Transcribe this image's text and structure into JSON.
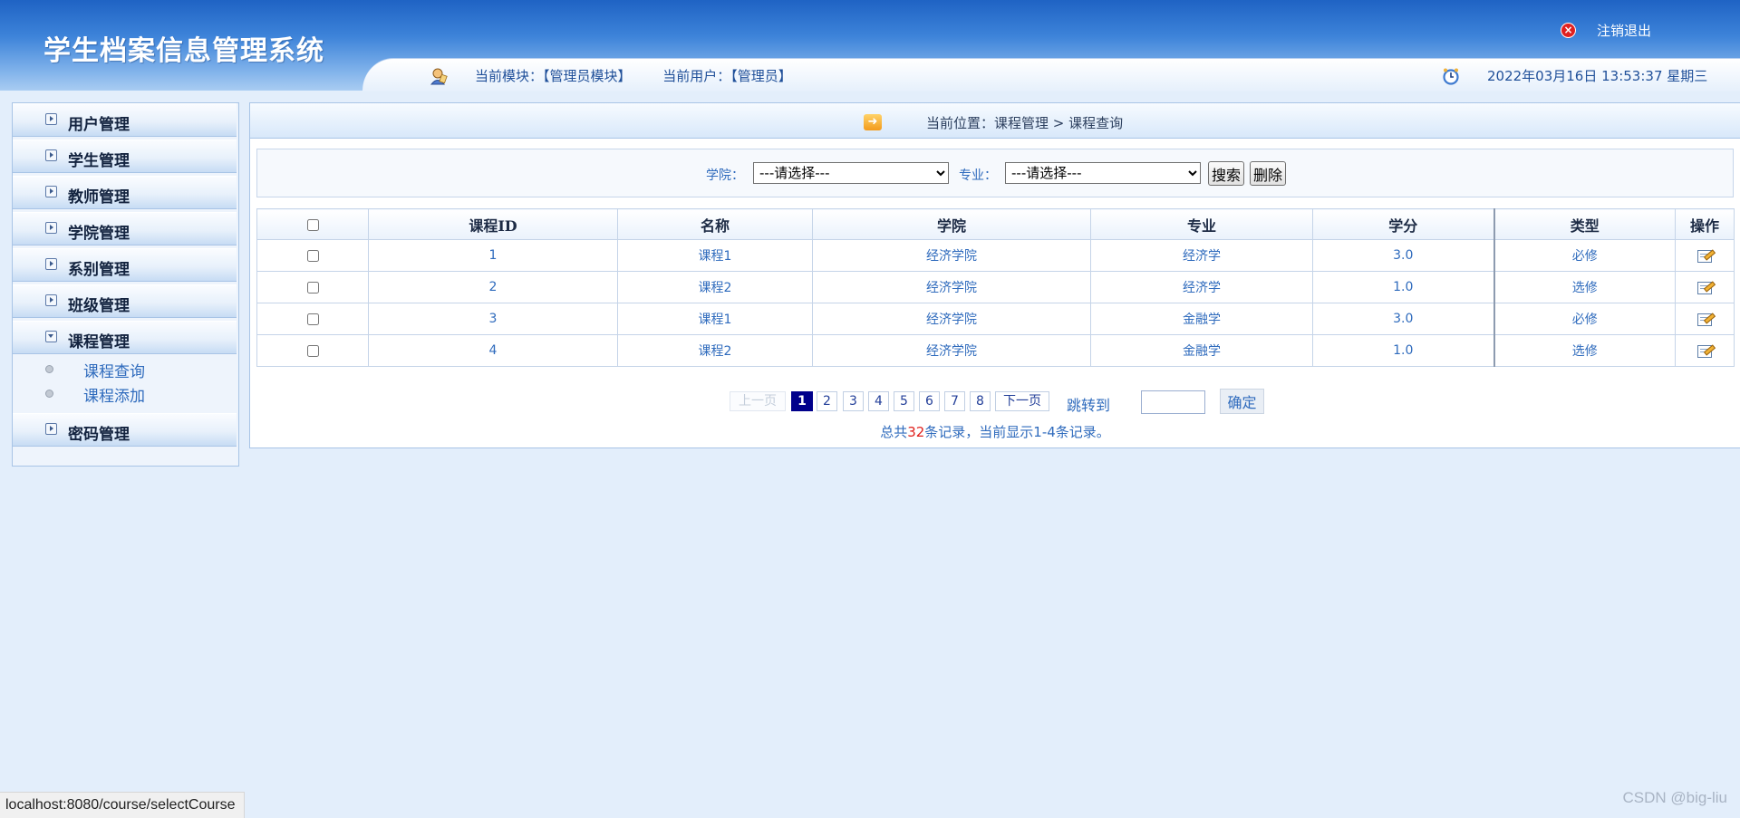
{
  "header": {
    "app_title": "学生档案信息管理系统",
    "logout_label": "注销退出",
    "module_text": "当前模块：【管理员模块】",
    "user_text": "当前用户：【管理员】",
    "datetime": "2022年03月16日 13:53:37 星期三"
  },
  "sidebar": {
    "menus": [
      {
        "label": "用户管理",
        "icon": "expand-icon"
      },
      {
        "label": "学生管理",
        "icon": "expand-icon"
      },
      {
        "label": "教师管理",
        "icon": "expand-icon"
      },
      {
        "label": "学院管理",
        "icon": "expand-icon"
      },
      {
        "label": "系别管理",
        "icon": "expand-icon"
      },
      {
        "label": "班级管理",
        "icon": "expand-icon"
      },
      {
        "label": "课程管理",
        "icon": "collapse-icon",
        "open": true
      },
      {
        "label": "密码管理",
        "icon": "expand-icon"
      }
    ],
    "course_submenu": [
      {
        "label": "课程查询"
      },
      {
        "label": "课程添加"
      }
    ]
  },
  "location": {
    "text": "当前位置：课程管理 > 课程查询"
  },
  "search": {
    "college_label": "学院：",
    "college_value": "---请选择---",
    "major_label": "专业：",
    "major_value": "---请选择---",
    "search_button": "搜索",
    "delete_button": "删除"
  },
  "table": {
    "columns": [
      "课程ID",
      "名称",
      "学院",
      "专业",
      "学分",
      "类型",
      "操作"
    ],
    "rows": [
      {
        "id": "1",
        "name": "课程1",
        "college": "经济学院",
        "major": "经济学",
        "credit": "3.0",
        "type": "必修"
      },
      {
        "id": "2",
        "name": "课程2",
        "college": "经济学院",
        "major": "经济学",
        "credit": "1.0",
        "type": "选修"
      },
      {
        "id": "3",
        "name": "课程1",
        "college": "经济学院",
        "major": "金融学",
        "credit": "3.0",
        "type": "必修"
      },
      {
        "id": "4",
        "name": "课程2",
        "college": "经济学院",
        "major": "金融学",
        "credit": "1.0",
        "type": "选修"
      }
    ]
  },
  "pagination": {
    "prev": "上一页",
    "pages": [
      "1",
      "2",
      "3",
      "4",
      "5",
      "6",
      "7",
      "8"
    ],
    "current_page": "1",
    "next": "下一页",
    "jump_label": "跳转到",
    "jump_value": "",
    "confirm": "确定",
    "summary_prefix": "总共",
    "total": "32",
    "summary_suffix": "条记录，当前显示1-4条记录。"
  },
  "status_url": "localhost:8080/course/selectCourse",
  "watermark": "CSDN @big-liu",
  "colors": {
    "header_blue": "#1f63c4",
    "link_blue": "#2f6bbd",
    "page_bg": "#e3eefb",
    "current_page": "#00008b",
    "count_red": "#e0201c",
    "logout_red": "#e02020"
  }
}
